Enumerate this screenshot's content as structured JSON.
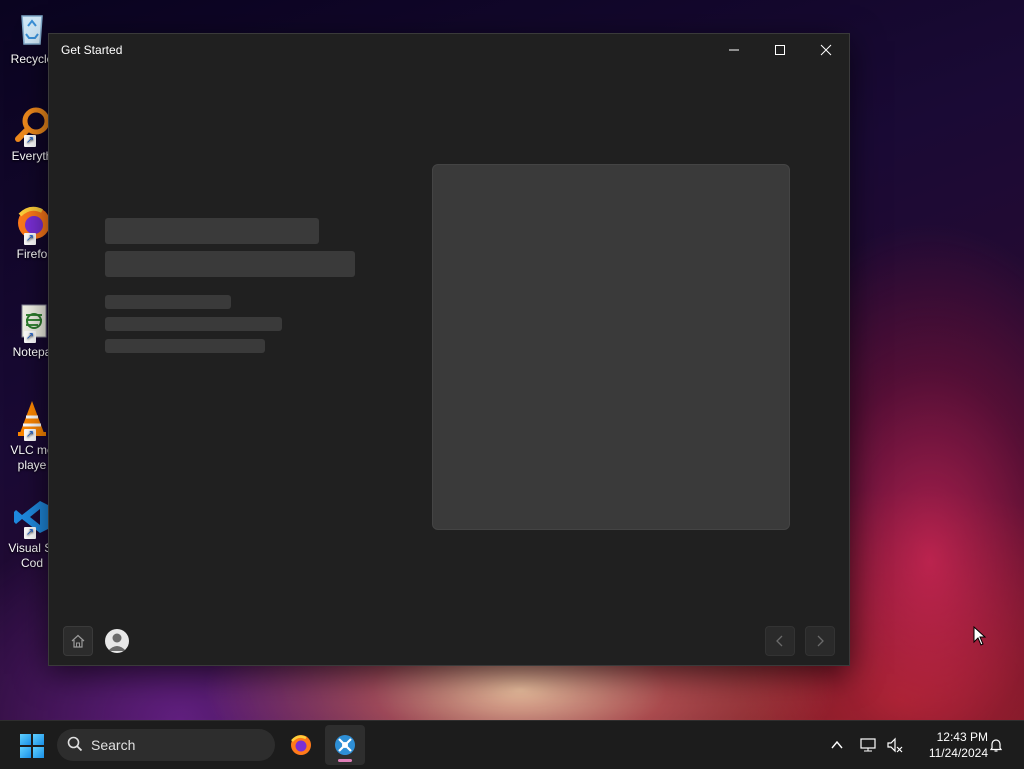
{
  "desktop": {
    "icons": [
      {
        "label": "Recycle",
        "icon": "recycle-bin-icon"
      },
      {
        "label": "Everyth",
        "icon": "everything-search-icon"
      },
      {
        "label": "Firefo",
        "icon": "firefox-icon"
      },
      {
        "label": "Notepa",
        "icon": "notepad-icon"
      },
      {
        "label": "VLC me",
        "label2": "playe",
        "icon": "vlc-icon"
      },
      {
        "label": "Visual St",
        "label2": "Cod",
        "icon": "vscode-icon"
      }
    ]
  },
  "window": {
    "title": "Get Started",
    "controls": {
      "minimize": "—",
      "maximize": "☐",
      "close": "✕"
    }
  },
  "taskbar": {
    "search_label": "Search",
    "time": "12:43 PM",
    "date": "11/24/2024"
  },
  "colors": {
    "window_bg": "#202020",
    "skeleton": "#3a3a3a",
    "taskbar_bg": "#1c1c1c",
    "accent_indicator": "#e07fb8"
  }
}
